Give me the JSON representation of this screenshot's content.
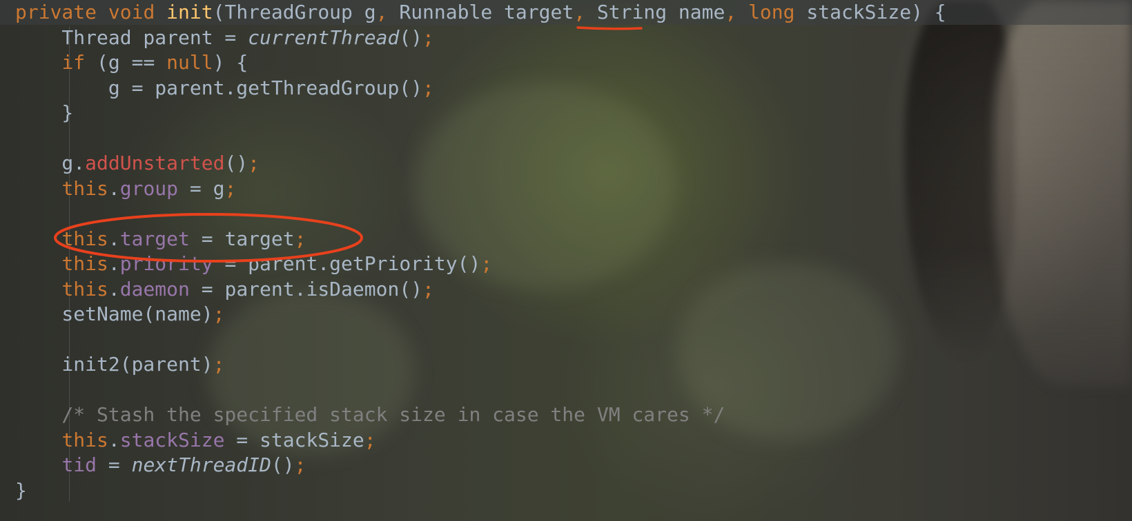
{
  "editor": {
    "lines": [
      [
        {
          "t": "private",
          "c": "kw"
        },
        {
          "t": " "
        },
        {
          "t": "void",
          "c": "kw"
        },
        {
          "t": " "
        },
        {
          "t": "init",
          "c": "fn"
        },
        {
          "t": "(ThreadGroup g"
        },
        {
          "t": ",",
          "c": "kw"
        },
        {
          "t": " Runnable target"
        },
        {
          "t": ",",
          "c": "kw"
        },
        {
          "t": " String name"
        },
        {
          "t": ",",
          "c": "kw"
        },
        {
          "t": " "
        },
        {
          "t": "long",
          "c": "kw"
        },
        {
          "t": " stackSize) {"
        }
      ],
      [
        {
          "t": "    Thread parent = "
        },
        {
          "t": "currentThread",
          "c": "st"
        },
        {
          "t": "()"
        },
        {
          "t": ";",
          "c": "kw"
        }
      ],
      [
        {
          "t": "    "
        },
        {
          "t": "if",
          "c": "kw"
        },
        {
          "t": " (g == "
        },
        {
          "t": "null",
          "c": "kw"
        },
        {
          "t": ") {"
        }
      ],
      [
        {
          "t": "        g = parent.getThreadGroup()"
        },
        {
          "t": ";",
          "c": "kw"
        }
      ],
      [
        {
          "t": "    }"
        }
      ],
      [],
      [
        {
          "t": "    g."
        },
        {
          "t": "addUnstarted",
          "c": "mcall"
        },
        {
          "t": "()"
        },
        {
          "t": ";",
          "c": "kw"
        }
      ],
      [
        {
          "t": "    "
        },
        {
          "t": "this",
          "c": "kw"
        },
        {
          "t": "."
        },
        {
          "t": "group",
          "c": "fld"
        },
        {
          "t": " = g"
        },
        {
          "t": ";",
          "c": "kw"
        }
      ],
      [],
      [
        {
          "t": "    "
        },
        {
          "t": "this",
          "c": "kw"
        },
        {
          "t": "."
        },
        {
          "t": "target",
          "c": "fld"
        },
        {
          "t": " = target"
        },
        {
          "t": ";",
          "c": "kw"
        }
      ],
      [
        {
          "t": "    "
        },
        {
          "t": "this",
          "c": "kw"
        },
        {
          "t": "."
        },
        {
          "t": "priority",
          "c": "fld"
        },
        {
          "t": " = parent.getPriority()"
        },
        {
          "t": ";",
          "c": "kw"
        }
      ],
      [
        {
          "t": "    "
        },
        {
          "t": "this",
          "c": "kw"
        },
        {
          "t": "."
        },
        {
          "t": "daemon",
          "c": "fld"
        },
        {
          "t": " = parent.isDaemon()"
        },
        {
          "t": ";",
          "c": "kw"
        }
      ],
      [
        {
          "t": "    setName(name)"
        },
        {
          "t": ";",
          "c": "kw"
        }
      ],
      [],
      [
        {
          "t": "    init2(parent)"
        },
        {
          "t": ";",
          "c": "kw"
        }
      ],
      [],
      [
        {
          "t": "    /* Stash the specified stack size in case the VM cares */",
          "c": "cm"
        }
      ],
      [
        {
          "t": "    "
        },
        {
          "t": "this",
          "c": "kw"
        },
        {
          "t": "."
        },
        {
          "t": "stackSize",
          "c": "fld"
        },
        {
          "t": " = stackSize"
        },
        {
          "t": ";",
          "c": "kw"
        }
      ],
      [
        {
          "t": "    "
        },
        {
          "t": "tid",
          "c": "fld"
        },
        {
          "t": " = "
        },
        {
          "t": "nextThreadID",
          "c": "st"
        },
        {
          "t": "()"
        },
        {
          "t": ";",
          "c": "kw"
        }
      ],
      [
        {
          "t": "}"
        }
      ]
    ]
  },
  "colors": {
    "keyword": "#cc7832",
    "method_decl": "#ffc66d",
    "field": "#9876aa",
    "plain": "#a9b7c6",
    "comment": "#808080",
    "annotation": "#e8411d"
  }
}
